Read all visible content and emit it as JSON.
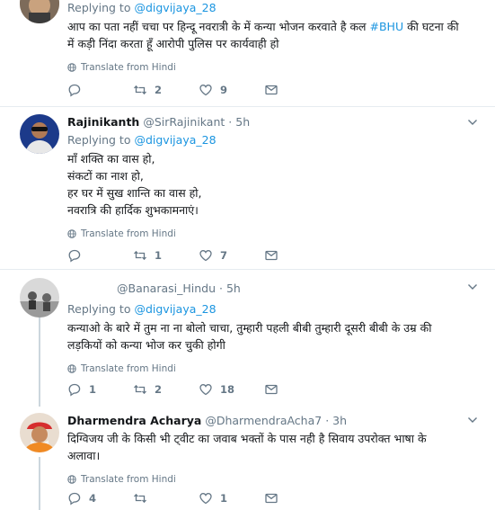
{
  "tweets": [
    {
      "replying_prefix": "Replying to",
      "replying_to": "@digvijaya_28",
      "text_parts": [
        "आप का पता नहीं चचा पर हिन्दू नवरात्री के में कन्या भोजन करवाते है कल ",
        "#BHU",
        " की घटना की"
      ],
      "text_line2": "में कड़ी निंदा करता हूँ आरोपी पुलिस पर कार्यवाही हो",
      "translate": "Translate from Hindi",
      "replies": "",
      "retweets": "2",
      "likes": "9"
    },
    {
      "name": "Rajinikanth",
      "handle": "@SirRajinikant",
      "dot": "·",
      "time": "5h",
      "replying_prefix": "Replying to",
      "replying_to": "@digvijaya_28",
      "lines": [
        "माँ शक्ति का वास हो,",
        "संकटों का नाश हो,",
        "हर घर में सुख शान्ति का वास हो,",
        "नवरात्रि की हार्दिक शुभकामनाएं।"
      ],
      "translate": "Translate from Hindi",
      "replies": "",
      "retweets": "1",
      "likes": "7"
    },
    {
      "name": "",
      "handle": "@Banarasi_Hindu",
      "dot": "·",
      "time": "5h",
      "replying_prefix": "Replying to",
      "replying_to": "@digvijaya_28",
      "lines": [
        "कन्याओ के बारे में तुम ना ना बोलो चाचा, तुम्हारी पहली बीबी तुम्हारी दूसरी बीबी के उम्र की",
        "लड़कियों को कन्या भोज कर चुकी होगी"
      ],
      "translate": "Translate from Hindi",
      "replies": "1",
      "retweets": "2",
      "likes": "18"
    },
    {
      "name": "Dharmendra Acharya",
      "handle": "@DharmendraAcha7",
      "dot": "·",
      "time": "3h",
      "lines": [
        "दिग्विजय जी के किसी भी ट्वीट का जवाब भक्तों के पास नही है सिवाय उपरोक्त भाषा के",
        "अलावा।"
      ],
      "translate": "Translate from Hindi",
      "replies": "4",
      "retweets": "",
      "likes": "1"
    }
  ],
  "colors": {
    "accent": "#1b95e0",
    "muted": "#657786",
    "border": "#e6ecf0"
  }
}
